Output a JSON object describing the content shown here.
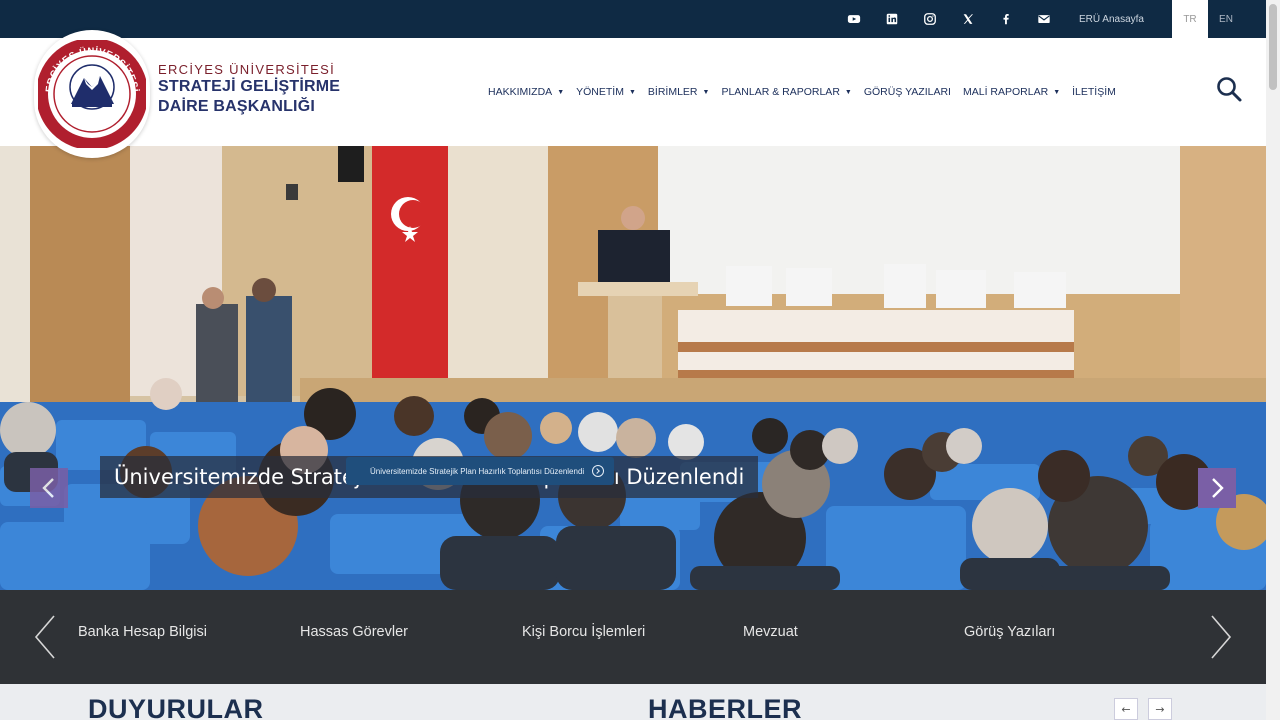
{
  "topbar": {
    "icons": [
      "youtube-icon",
      "linkedin-icon",
      "instagram-icon",
      "x-icon",
      "facebook-icon",
      "mail-icon"
    ],
    "portal_label": "ERÜ Anasayfa",
    "lang_tr": "TR",
    "lang_en": "EN",
    "bg_color": "#0f2a44"
  },
  "brand": {
    "university": "ERCİYES ÜNİVERSİTESİ",
    "dept_line1": "STRATEJİ GELİŞTİRME",
    "dept_line2": "DAİRE BAŞKANLIĞI",
    "logo_ring_text": "ERCİYES ÜNİVERSİTESİ",
    "logo_year": "1978"
  },
  "nav": {
    "items": [
      {
        "label": "HAKKIMIZDA",
        "dropdown": true
      },
      {
        "label": "YÖNETİM",
        "dropdown": true
      },
      {
        "label": "BİRİMLER",
        "dropdown": true
      },
      {
        "label": "PLANLAR & RAPORLAR",
        "dropdown": true
      },
      {
        "label": "GÖRÜŞ YAZILARI",
        "dropdown": false
      },
      {
        "label": "MALİ RAPORLAR",
        "dropdown": true
      },
      {
        "label": "İLETİŞİM",
        "dropdown": false
      }
    ],
    "search_icon": "search-icon"
  },
  "hero": {
    "caption": "Üniversitemizde Stratejik Plan Hazırlık Toplantısı Düzenlendi",
    "pill_label": "Üniversitemizde Stratejik Plan Hazırlık Toplantısı Düzenlendi",
    "accent_color": "#7a5fa6"
  },
  "quick_links": {
    "items": [
      "Banka Hesap Bilgisi",
      "Hassas Görevler",
      "Kişi Borcu İşlemleri",
      "Mevzuat",
      "Görüş Yazıları"
    ],
    "bg_color": "#2f3236"
  },
  "sections": {
    "announcements": "DUYURULAR",
    "news": "HABERLER",
    "prev": "←",
    "next": "→"
  }
}
